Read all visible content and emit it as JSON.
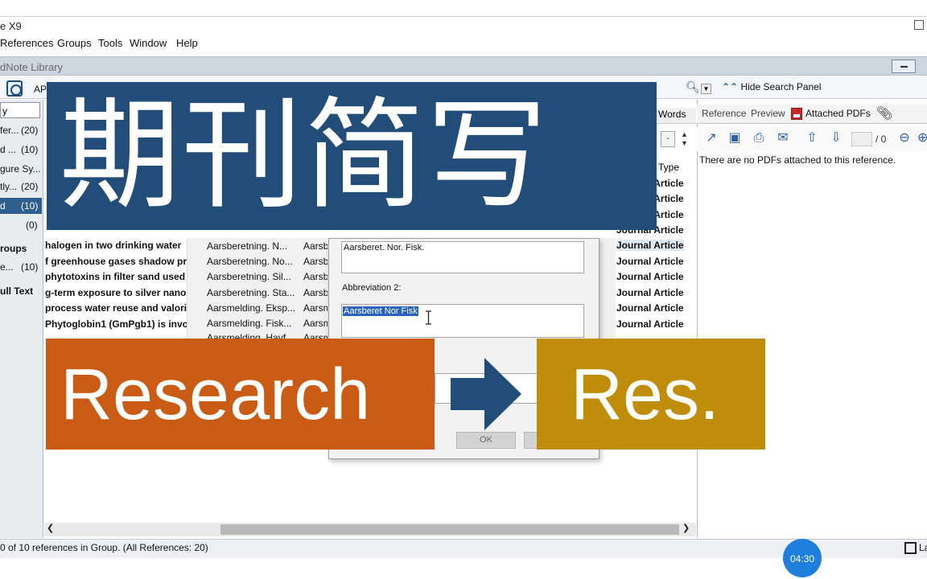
{
  "window": {
    "title": "e X9"
  },
  "menu": [
    "References",
    "Groups",
    "Tools",
    "Window",
    "Help"
  ],
  "library": {
    "title": "dNote Library"
  },
  "toolbar": {
    "style_label": "AP",
    "hide_search_panel": "Hide Search Panel",
    "icons": [
      "globe-icon",
      "search-icon",
      "dropdown-icon",
      "chevron-up-icon"
    ]
  },
  "groups": {
    "search_text": "y",
    "items": [
      {
        "name": "fer...",
        "count": "(20)"
      },
      {
        "name": "d ...",
        "count": "(10)"
      },
      {
        "name": "gure Sy...",
        "count": ""
      },
      {
        "name": "tly...",
        "count": "(20)"
      },
      {
        "name": "d",
        "count": "(10)",
        "selected": true
      },
      {
        "name": "",
        "count": "(0)"
      }
    ],
    "section_heading": "roups",
    "section_item": {
      "name": "e...",
      "count": "(10)"
    },
    "full_text_heading": "ull Text"
  },
  "list": {
    "words_header": "Words",
    "type_header": "Type",
    "spin_value": "-",
    "journal_type": "Journal Article",
    "titles": [
      "halogen in two drinking water",
      "f greenhouse gases shadow pri",
      "phytotoxins in filter sand used f",
      "g-term exposure to silver nano",
      "process water reuse and valori",
      "Phytoglobin1 (GmPgb1) is invo"
    ],
    "abbreviations": [
      {
        "full": "Aarsberetning. N...",
        "short": "Aarsb"
      },
      {
        "full": "Aarsberetning. No...",
        "short": "Aarsb"
      },
      {
        "full": "Aarsberetning. Sil...",
        "short": "Aarsb"
      },
      {
        "full": "Aarsberetning. Sta...",
        "short": "Aarsb"
      },
      {
        "full": "Aarsmelding. Eksp...",
        "short": "Aarsm"
      },
      {
        "full": "Aarsmelding. Fisk...",
        "short": "Aarsm"
      },
      {
        "full": "Aarsmelding. Havf...",
        "short": "Aarsm"
      }
    ]
  },
  "dialog": {
    "abbreviation1_value": "Aarsberet. Nor. Fisk.",
    "abbreviation2_label": "Abbreviation 2:",
    "abbreviation2_value": "Aarsberet Nor Fisk",
    "ok_label": "OK"
  },
  "right_panel": {
    "tabs": [
      "Reference",
      "Preview",
      "Attached PDFs"
    ],
    "page_count": "/ 0",
    "no_pdfs_message": "There are no PDFs attached to this reference.",
    "tool_icons": [
      "open-external-icon",
      "save-icon",
      "print-icon",
      "email-icon",
      "arrow-up-icon",
      "arrow-down-icon",
      "zoom-out-icon",
      "zoom-in-icon"
    ]
  },
  "status": {
    "text": "0 of 10 references in Group. (All References: 20)",
    "timer": "04:30",
    "layout_label": "La"
  },
  "overlay": {
    "title": "期刊简写",
    "from_word": "Research",
    "to_word": "Res.",
    "colors": {
      "blue": "#214d78",
      "orange": "#c95b14",
      "gold": "#bf8d09"
    }
  }
}
